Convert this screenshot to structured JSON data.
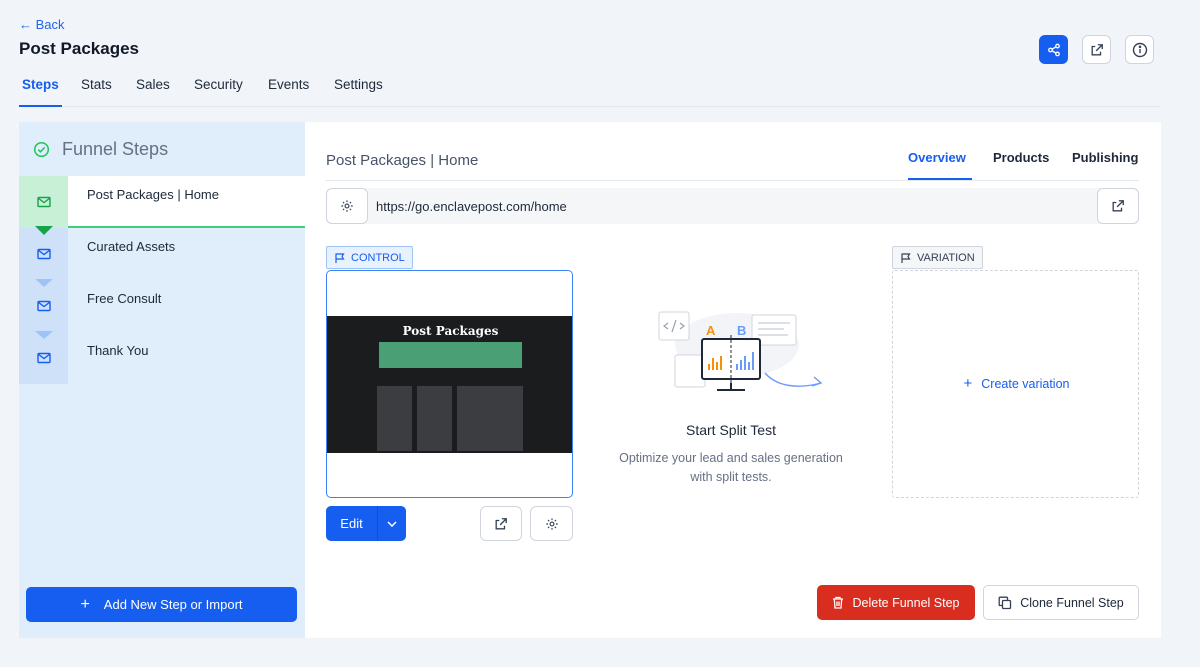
{
  "header": {
    "back_label": "← Back",
    "title": "Post Packages"
  },
  "tabs": [
    {
      "label": "Steps",
      "active": true
    },
    {
      "label": "Stats"
    },
    {
      "label": "Sales"
    },
    {
      "label": "Security"
    },
    {
      "label": "Events"
    },
    {
      "label": "Settings"
    }
  ],
  "sidebar": {
    "title": "Funnel Steps",
    "steps": [
      {
        "label": "Post Packages | Home",
        "active": true,
        "icon": "mail-icon"
      },
      {
        "label": "Curated Assets",
        "icon": "mail-icon"
      },
      {
        "label": "Free Consult",
        "icon": "mail-icon"
      },
      {
        "label": "Thank You",
        "icon": "mail-icon"
      }
    ],
    "add_button": "Add New Step or Import"
  },
  "main": {
    "step_title": "Post Packages | Home",
    "tabs": [
      {
        "label": "Overview",
        "active": true
      },
      {
        "label": "Products"
      },
      {
        "label": "Publishing"
      }
    ],
    "url": "https://go.enclavepost.com/home",
    "control_label": "CONTROL",
    "variation_label": "VARIATION",
    "preview": {
      "title": "Post Packages"
    },
    "edit_label": "Edit",
    "split_test": {
      "title": "Start Split Test",
      "description": "Optimize your lead and sales generation with split tests.",
      "label_a": "A",
      "label_b": "B"
    },
    "create_variation": "Create variation",
    "delete_button": "Delete Funnel Step",
    "clone_button": "Clone Funnel Step"
  },
  "colors": {
    "accent": "#155eef",
    "danger": "#d92d20",
    "success": "#3ccf7a",
    "sidebar_bg": "#e0edfb"
  }
}
